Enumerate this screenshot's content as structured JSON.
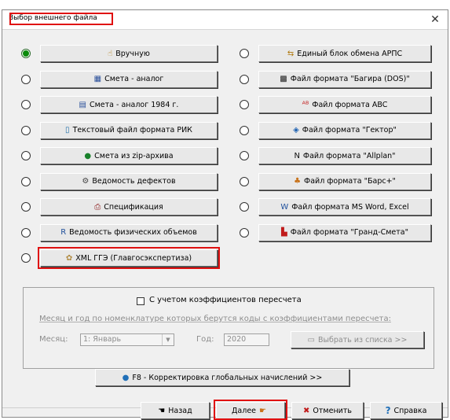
{
  "window": {
    "title": "Выбор внешнего файла",
    "close_glyph": "✕"
  },
  "left_options": [
    {
      "label": "Вручную",
      "icon": "hand-pointer-icon",
      "glyph": "☝",
      "color": "#b07a10",
      "selected": true
    },
    {
      "label": "Смета - аналог",
      "icon": "table-icon",
      "glyph": "▦",
      "color": "#2a4f9a",
      "selected": false
    },
    {
      "label": "Смета - аналог 1984 г.",
      "icon": "spreadsheet-icon",
      "glyph": "▤",
      "color": "#2a4f9a",
      "selected": false
    },
    {
      "label": "Текстовый файл формата РИК",
      "icon": "text-file-icon",
      "glyph": "▯",
      "color": "#1f6fa8",
      "selected": false
    },
    {
      "label": "Смета из zip-архива",
      "icon": "zip-archive-icon",
      "glyph": "●",
      "color": "#18802a",
      "selected": false
    },
    {
      "label": "Ведомость дефектов",
      "icon": "gear-wrench-icon",
      "glyph": "⚙",
      "color": "#444444",
      "selected": false
    },
    {
      "label": "Спецификация",
      "icon": "printer-icon",
      "glyph": "⎙",
      "color": "#8a1a1a",
      "selected": false
    },
    {
      "label": "Ведомость физических объемов",
      "icon": "r-letter-icon",
      "glyph": "R",
      "color": "#1f4f9a",
      "selected": false
    },
    {
      "label": "XML ГГЭ (Главгосэкспертиза)",
      "icon": "emblem-icon",
      "glyph": "✿",
      "color": "#b08a40",
      "selected": false
    }
  ],
  "right_options": [
    {
      "label": "Единый блок обмена АРПС",
      "icon": "exchange-icon",
      "glyph": "⇆",
      "color": "#b07a10",
      "selected": false
    },
    {
      "label": "Файл формата \"Багира (DOS)\"",
      "icon": "panther-icon",
      "glyph": "▩",
      "color": "#222222",
      "selected": false
    },
    {
      "label": "Файл формата ABC",
      "icon": "abc-icon",
      "glyph": "ᴬᴮ",
      "color": "#c21a1a",
      "selected": false
    },
    {
      "label": "Файл формата \"Гектор\"",
      "icon": "diamond-icon",
      "glyph": "◈",
      "color": "#1a5fb0",
      "selected": false
    },
    {
      "label": "Файл формата \"Allplan\"",
      "icon": "allplan-icon",
      "glyph": "N",
      "color": "#111111",
      "selected": false
    },
    {
      "label": "Файл формата \"Барс+\"",
      "icon": "bars-icon",
      "glyph": "♣",
      "color": "#c8721a",
      "selected": false
    },
    {
      "label": "Файл формата MS Word, Excel",
      "icon": "word-excel-icon",
      "glyph": "W",
      "color": "#1e4f9c",
      "selected": false
    },
    {
      "label": "Файл формата \"Гранд-Смета\"",
      "icon": "grand-smeta-icon",
      "glyph": "▙",
      "color": "#c01a1a",
      "selected": false
    }
  ],
  "recalc": {
    "checkbox_label": "С учетом коэффициентов пересчета",
    "checked": false,
    "info_text": "Месяц и год по номенклатуре которых берутся коды  с коэффициентами пересчета:",
    "month_label": "Месяц:",
    "month_value": "1: Январь",
    "year_label": "Год:",
    "year_value": "2020",
    "select_button_label": "Выбрать из списка >>",
    "select_button_glyph": "▭"
  },
  "global_button": {
    "label": "F8 - Корректировка глобальных начислений >>",
    "glyph": "●",
    "color": "#1f6fb8"
  },
  "footer": {
    "back_label": "Назад",
    "back_glyph": "☚",
    "next_label": "Далее",
    "next_glyph": "☛",
    "cancel_label": "Отменить",
    "cancel_glyph": "✖",
    "help_label": "Справка",
    "help_glyph": "?"
  },
  "colors": {
    "highlight": "#e01010",
    "selected_radio": "#0a8a0a"
  }
}
